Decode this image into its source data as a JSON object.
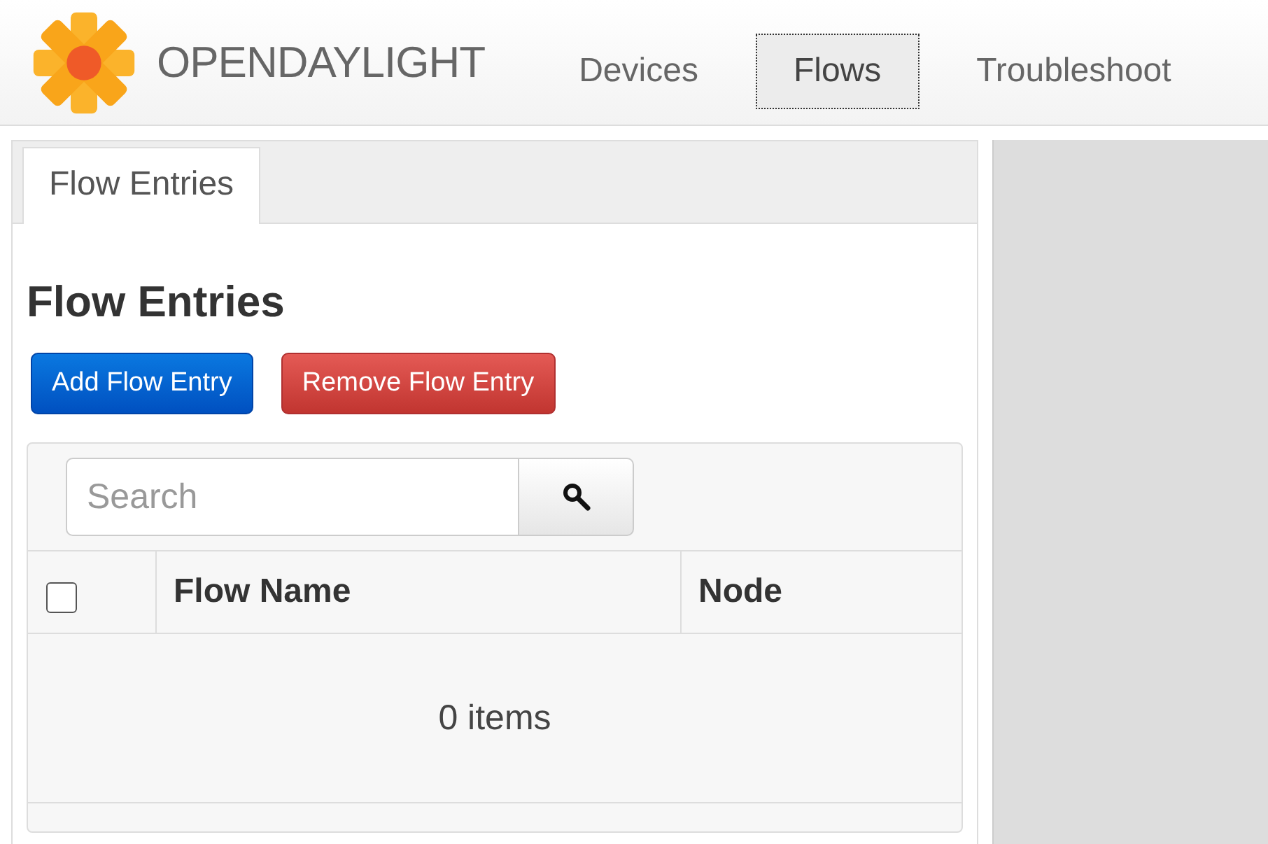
{
  "header": {
    "logo_text": "OPENDAYLIGHT",
    "nav": [
      {
        "label": "Devices",
        "selected": false
      },
      {
        "label": "Flows",
        "selected": true
      },
      {
        "label": "Troubleshoot",
        "selected": false
      }
    ]
  },
  "panel": {
    "tabs": [
      {
        "label": "Flow Entries",
        "selected": true
      }
    ],
    "heading": "Flow Entries",
    "buttons": [
      {
        "label": "Add Flow Entry",
        "kind": "primary"
      },
      {
        "label": "Remove Flow Entry",
        "kind": "danger"
      }
    ],
    "search": {
      "placeholder": "Search"
    },
    "table": {
      "select_all_checked": false,
      "columns": [
        "Flow Name",
        "Node"
      ],
      "empty_text": "0 items"
    }
  }
}
